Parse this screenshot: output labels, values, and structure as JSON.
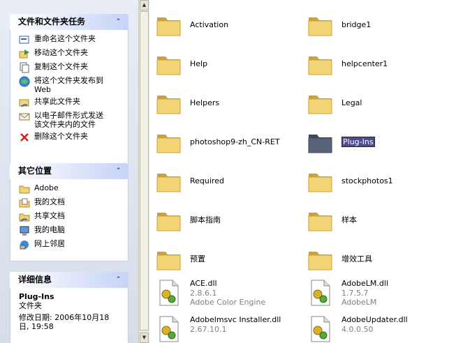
{
  "taskpane": {
    "file_tasks": {
      "title": "文件和文件夹任务",
      "items": [
        {
          "label": "重命名这个文件夹",
          "icon": "rename-icon"
        },
        {
          "label": "移动这个文件夹",
          "icon": "move-icon"
        },
        {
          "label": "复制这个文件夹",
          "icon": "copy-icon"
        },
        {
          "label": "将这个文件夹发布到",
          "label2": "Web",
          "icon": "publish-web-icon"
        },
        {
          "label": "共享此文件夹",
          "icon": "share-icon"
        },
        {
          "label": "以电子邮件形式发送",
          "label2": "该文件夹内的文件",
          "icon": "email-icon"
        },
        {
          "label": "删除这个文件夹",
          "icon": "delete-icon"
        }
      ]
    },
    "other_places": {
      "title": "其它位置",
      "items": [
        {
          "label": "Adobe",
          "icon": "folder-icon"
        },
        {
          "label": "我的文档",
          "icon": "my-documents-icon"
        },
        {
          "label": "共享文档",
          "icon": "shared-documents-icon"
        },
        {
          "label": "我的电脑",
          "icon": "my-computer-icon"
        },
        {
          "label": "网上邻居",
          "icon": "network-icon"
        }
      ]
    },
    "details": {
      "title": "详细信息",
      "name": "Plug-Ins",
      "type": "文件夹",
      "modified_line1": "修改日期: 2006年10月18",
      "modified_line2": "日, 19:58"
    }
  },
  "files": [
    {
      "name": "Activation",
      "kind": "folder"
    },
    {
      "name": "bridge1",
      "kind": "folder"
    },
    {
      "name": "Help",
      "kind": "folder"
    },
    {
      "name": "helpcenter1",
      "kind": "folder"
    },
    {
      "name": "Helpers",
      "kind": "folder"
    },
    {
      "name": "Legal",
      "kind": "folder"
    },
    {
      "name": "photoshop9-zh_CN-RET",
      "kind": "folder"
    },
    {
      "name": "Plug-Ins",
      "kind": "folder",
      "selected": true
    },
    {
      "name": "Required",
      "kind": "folder"
    },
    {
      "name": "stockphotos1",
      "kind": "folder"
    },
    {
      "name": "脚本指南",
      "kind": "folder"
    },
    {
      "name": "样本",
      "kind": "folder"
    },
    {
      "name": "预置",
      "kind": "folder"
    },
    {
      "name": "增效工具",
      "kind": "folder"
    },
    {
      "name": "ACE.dll",
      "kind": "dll",
      "version": "2.8.6.1",
      "description": "Adobe Color Engine"
    },
    {
      "name": "AdobeLM.dll",
      "kind": "dll",
      "version": "1.7.5.7",
      "description": "AdobeLM"
    },
    {
      "name": "Adobelmsvc Installer.dll",
      "kind": "dll",
      "version": "2.67.10.1",
      "description": ""
    },
    {
      "name": "AdobeUpdater.dll",
      "kind": "dll",
      "version": "4.0.0.50",
      "description": ""
    }
  ],
  "colors": {
    "folder": "#f2d476",
    "folder_selected": "#5a6478",
    "panel_head": "#c6d3f7"
  }
}
